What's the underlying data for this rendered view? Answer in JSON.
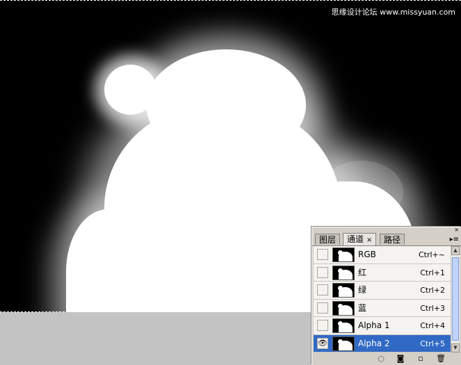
{
  "watermark": "思缘设计论坛 www.missyuan.com",
  "panel": {
    "tabs": [
      {
        "label": "图层"
      },
      {
        "label": "通道",
        "close": "×"
      },
      {
        "label": "路径"
      }
    ],
    "menu_glyph": "▸≡",
    "top_close_glyph": "×",
    "channels": [
      {
        "name": "RGB",
        "shortcut": "Ctrl+~",
        "visible": false
      },
      {
        "name": "红",
        "shortcut": "Ctrl+1",
        "visible": false
      },
      {
        "name": "绿",
        "shortcut": "Ctrl+2",
        "visible": false
      },
      {
        "name": "蓝",
        "shortcut": "Ctrl+3",
        "visible": false
      },
      {
        "name": "Alpha 1",
        "shortcut": "Ctrl+4",
        "visible": false
      },
      {
        "name": "Alpha 2",
        "shortcut": "Ctrl+5",
        "visible": true,
        "selected": true
      }
    ],
    "eye_glyph": "👁",
    "scroll_up": "▲",
    "scroll_down": "▼",
    "footer_icons": [
      {
        "name": "load-selection-icon",
        "glyph": "◌"
      },
      {
        "name": "save-selection-icon",
        "glyph": "◙"
      },
      {
        "name": "new-channel-icon",
        "glyph": "▫"
      },
      {
        "name": "delete-channel-icon",
        "glyph": "🗑"
      }
    ]
  },
  "colors": {
    "selection": "#316ac5",
    "canvas": "#000000",
    "workspace": "#c3c3c3"
  }
}
